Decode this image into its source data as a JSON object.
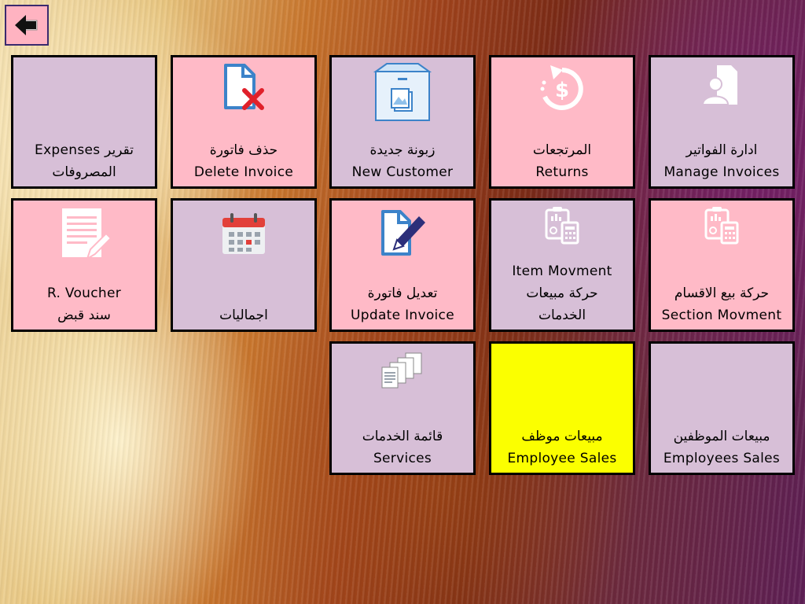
{
  "back_button": {
    "icon": "back-arrow-icon"
  },
  "tiles": [
    {
      "id": "expenses",
      "line1": "Expenses تقرير",
      "line2": "المصروفات",
      "color": "#d7bfd7",
      "icon": ""
    },
    {
      "id": "delete-invoice",
      "line1": "حذف فاتورة",
      "line2": "Delete Invoice",
      "color": "#ffbac7",
      "icon": "document-delete-icon"
    },
    {
      "id": "new-customer",
      "line1": "زبونة جديدة",
      "line2": "New Customer",
      "color": "#d7bfd7",
      "icon": "image-box-icon"
    },
    {
      "id": "returns",
      "line1": "المرتجعات",
      "line2": "Returns",
      "color": "#ffbac7",
      "icon": "refund-dollar-icon"
    },
    {
      "id": "manage-invoices",
      "line1": "ادارة الفواتير",
      "line2": "Manage Invoices",
      "color": "#d7bfd7",
      "icon": "user-document-icon"
    },
    {
      "id": "r-voucher",
      "line1": "R. Voucher",
      "line2": "سند قبض",
      "color": "#ffbac7",
      "icon": "edit-list-icon"
    },
    {
      "id": "totals",
      "line1": "",
      "line2": "اجماليات",
      "color": "#d7bfd7",
      "icon": "calendar-icon"
    },
    {
      "id": "update-invoice",
      "line1": "تعديل فاتورة",
      "line2": "Update Invoice",
      "color": "#ffbac7",
      "icon": "document-pen-icon"
    },
    {
      "id": "item-movement",
      "line0": "Item Movment",
      "line1": "حركة مبيعات",
      "line2": "الخدمات",
      "color": "#d7bfd7",
      "icon": "report-calculator-icon"
    },
    {
      "id": "section-movement",
      "line1": "حركة بيع الاقسام",
      "line2": "Section Movment",
      "color": "#ffbac7",
      "icon": "report-calculator-icon"
    },
    {
      "id": "services",
      "line1": "قائمة الخدمات",
      "line2": "Services",
      "color": "#d7bfd7",
      "icon": "documents-stack-icon"
    },
    {
      "id": "employee-sales",
      "line1": "مبيعات موظف",
      "line2": "Employee Sales",
      "color": "#fbff00",
      "icon": ""
    },
    {
      "id": "employees-sales",
      "line1": "مبيعات الموظفين",
      "line2": "Employees Sales",
      "color": "#d7bfd7",
      "icon": ""
    }
  ]
}
